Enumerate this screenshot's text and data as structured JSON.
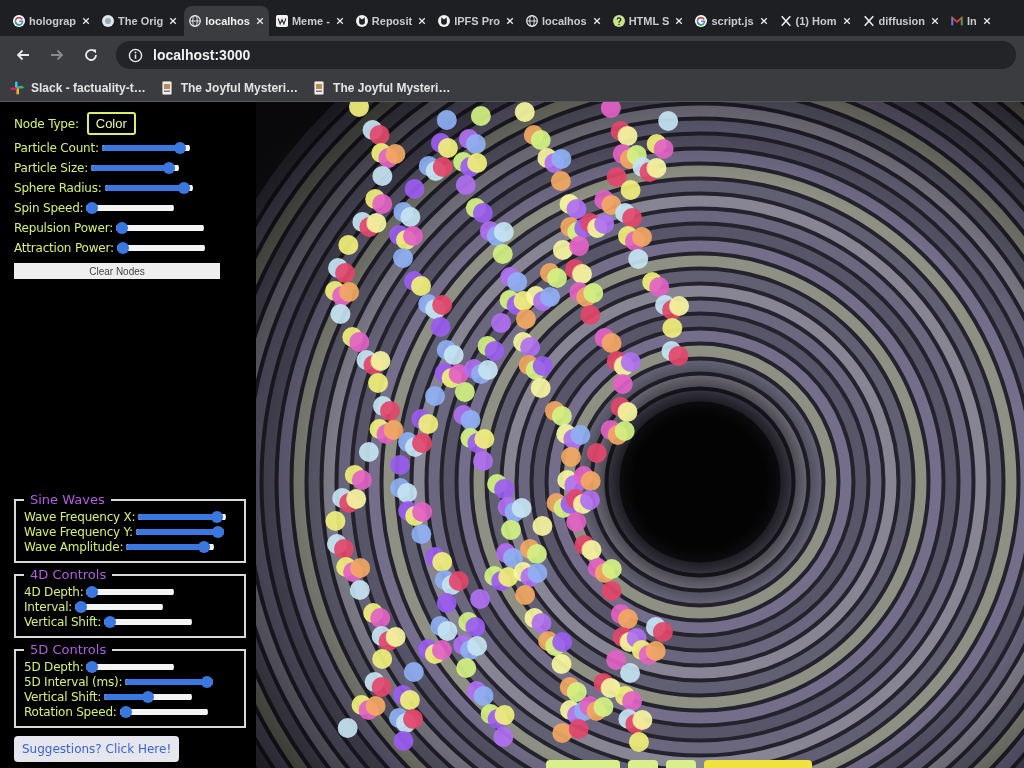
{
  "browser": {
    "tabs": [
      {
        "title": "holograp",
        "selected": false
      },
      {
        "title": "The Orig",
        "selected": false
      },
      {
        "title": "localhos",
        "selected": true
      },
      {
        "title": "Meme -",
        "selected": false
      },
      {
        "title": "Reposit",
        "selected": false
      },
      {
        "title": "IPFS Pro",
        "selected": false
      },
      {
        "title": "localhos",
        "selected": false
      },
      {
        "title": "HTML S",
        "selected": false
      },
      {
        "title": "script.js",
        "selected": false
      },
      {
        "title": "(1) Hom",
        "selected": false
      },
      {
        "title": "diffusion",
        "selected": false
      },
      {
        "title": "In",
        "selected": false
      }
    ],
    "toolbar": {
      "back_disabled": false,
      "forward_disabled": true,
      "url": "localhost:3000"
    },
    "bookmarks": [
      {
        "title": "Slack - factuality-t…"
      },
      {
        "title": "The Joyful Mysteri…"
      },
      {
        "title": "The Joyful Mysteri…"
      }
    ]
  },
  "controls": {
    "node_type": {
      "label": "Node Type:",
      "value": "Color"
    },
    "sliders": [
      {
        "label": "Particle Count:",
        "level": 0.95
      },
      {
        "label": "Particle Size:",
        "level": 0.95
      },
      {
        "label": "Sphere Radius:",
        "level": 0.97
      },
      {
        "label": "Spin Speed:",
        "level": 0
      },
      {
        "label": "Repulsion Power:",
        "level": 0
      },
      {
        "label": "Attraction Power:",
        "level": 0
      }
    ],
    "clear_button": "Clear Nodes"
  },
  "groups": [
    {
      "legend": "Sine Waves",
      "sliders": [
        {
          "label": "Wave Frequency X:",
          "level": 0.96
        },
        {
          "label": "Wave Frequency Y:",
          "level": 1
        },
        {
          "label": "Wave Amplitude:",
          "level": 0.95
        }
      ]
    },
    {
      "legend": "4D Controls",
      "sliders": [
        {
          "label": "4D Depth:",
          "level": 0
        },
        {
          "label": "Interval:",
          "level": 0
        },
        {
          "label": "Vertical Shift:",
          "level": 0
        }
      ]
    },
    {
      "legend": "5D Controls",
      "sliders": [
        {
          "label": "5D Depth:",
          "level": 0
        },
        {
          "label": "5D Interval (ms):",
          "level": 1
        },
        {
          "label": "Vertical Shift:",
          "level": 0.5
        },
        {
          "label": "Rotation Speed:",
          "level": 0
        }
      ]
    }
  ],
  "suggestions_button": "Suggestions? Click Here!"
}
